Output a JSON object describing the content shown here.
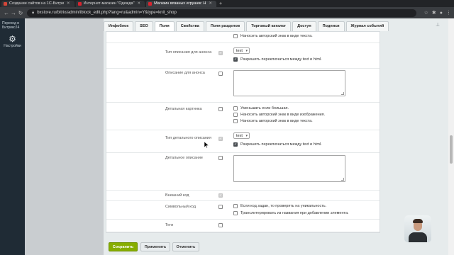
{
  "browser": {
    "tabs": [
      {
        "label": "Создание сайтов на 1С-Битри",
        "active": false,
        "favicon_color": "#d44638"
      },
      {
        "label": "Интернет-магазин \"Одежда\"",
        "active": false,
        "favicon_color": "#d8242f"
      },
      {
        "label": "Магазин вязаных игрушек: Н",
        "active": true,
        "favicon_color": "#d8242f"
      }
    ],
    "new_tab": "+",
    "url": "bxstore.ru/bitrix/admin/iblock_edit.php?lang=ru&admin=Y&type=knit_shop"
  },
  "left_panel": {
    "goto_label": "Переход в Битрикс24",
    "settings_label": "Настройки"
  },
  "form_tabs": [
    "Инфоблок",
    "SEO",
    "Поля",
    "Свойства",
    "Поля разделов",
    "Торговый каталог",
    "Доступ",
    "Подписи",
    "Журнал событий"
  ],
  "active_tab": "Поля",
  "form": {
    "top_option": "Наносить авторский знак в виде текста.",
    "preview_type": {
      "label": "Тип описания для анонса",
      "select": "text",
      "option": "Разрешить переключаться между text и html."
    },
    "preview_text": {
      "label": "Описание для анонса"
    },
    "detail_picture": {
      "label": "Детальная картинка",
      "options": [
        "Уменьшать если большая.",
        "Наносить авторский знак в виде изображения.",
        "Наносить авторский знак в виде текста."
      ]
    },
    "detail_type": {
      "label": "Тип детального описания",
      "select": "text",
      "option": "Разрешить переключаться между text и html."
    },
    "detail_text": {
      "label": "Детальное описание"
    },
    "xml_id": {
      "label": "Внешний код"
    },
    "code": {
      "label": "Символьный код",
      "options": [
        "Если код задан, то проверять на уникальность.",
        "Транслитерировать из названия при добавлении элемента."
      ]
    },
    "tags": {
      "label": "Теги"
    }
  },
  "buttons": {
    "save": "Сохранить",
    "apply": "Применить",
    "cancel": "Отменить"
  }
}
